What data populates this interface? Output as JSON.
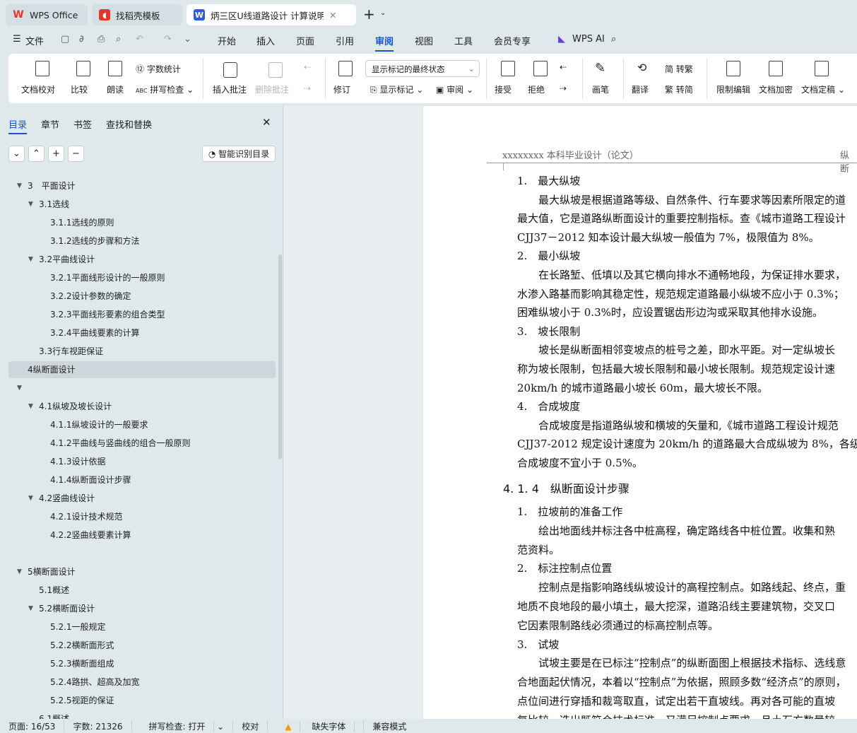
{
  "tabs": [
    {
      "label": "WPS Office",
      "icon": "wps-logo-icon"
    },
    {
      "label": "找稻壳模板",
      "icon": "docer-logo-icon"
    },
    {
      "label": "炳三区U线道路设计 计算说明书",
      "icon": "word-doc-icon",
      "active": true
    }
  ],
  "menu": {
    "file": "文件",
    "items": [
      "开始",
      "插入",
      "页面",
      "引用",
      "审阅",
      "视图",
      "工具",
      "会员专享"
    ],
    "active": "审阅",
    "ai": "WPS AI"
  },
  "ribbon": {
    "proofread": "文档校对",
    "compare": "比较",
    "read_aloud": "朗读",
    "word_count": "字数统计",
    "spell_check": "拼写检查",
    "insert_comment": "插入批注",
    "delete_comment": "删除批注",
    "track": "修订",
    "markup_state": "显示标记的最终状态",
    "show_markup": "显示标记",
    "review_pane": "审阅",
    "accept": "接受",
    "reject": "拒绝",
    "pen": "画笔",
    "translate": "翻译",
    "to_traditional": "转繁",
    "to_simplified": "转简",
    "restrict_edit": "限制编辑",
    "encrypt": "文档加密",
    "finalize": "文档定稿"
  },
  "sidebar": {
    "tabs": [
      "目录",
      "章节",
      "书签",
      "查找和替换"
    ],
    "active_tab": "目录",
    "smart_toc": "智能识别目录",
    "toc": [
      {
        "label": "3　平面设计",
        "level": 0,
        "expanded": true
      },
      {
        "label": "3.1选线",
        "level": 1,
        "expanded": true
      },
      {
        "label": "3.1.1选线的原则",
        "level": 2
      },
      {
        "label": "3.1.2选线的步骤和方法",
        "level": 2
      },
      {
        "label": "3.2平曲线设计",
        "level": 1,
        "expanded": true
      },
      {
        "label": "3.2.1平面线形设计的一般原则",
        "level": 2
      },
      {
        "label": "3.2.2设计参数的确定",
        "level": 2
      },
      {
        "label": "3.2.3平面线形要素的组合类型",
        "level": 2
      },
      {
        "label": "3.2.4平曲线要素的计算",
        "level": 2
      },
      {
        "label": "3.3行车视距保证",
        "level": 1
      },
      {
        "label": "4纵断面设计",
        "level": 0,
        "selected": true
      },
      {
        "label": "",
        "level": 0,
        "expanded": true
      },
      {
        "label": "4.1纵坡及坡长设计",
        "level": 1,
        "expanded": true
      },
      {
        "label": "4.1.1纵坡设计的一般要求",
        "level": 2
      },
      {
        "label": "4.1.2平曲线与竖曲线的组合一般原则",
        "level": 2
      },
      {
        "label": "4.1.3设计依据",
        "level": 2
      },
      {
        "label": "4.1.4纵断面设计步骤",
        "level": 2
      },
      {
        "label": "4.2竖曲线设计",
        "level": 1,
        "expanded": true
      },
      {
        "label": "4.2.1设计技术规范",
        "level": 2
      },
      {
        "label": "4.2.2竖曲线要素计算",
        "level": 2
      },
      {
        "label": "",
        "level": 0
      },
      {
        "label": "5横断面设计",
        "level": 0,
        "expanded": true
      },
      {
        "label": "5.1概述",
        "level": 1
      },
      {
        "label": "5.2横断面设计",
        "level": 1,
        "expanded": true
      },
      {
        "label": "5.2.1一般规定",
        "level": 2
      },
      {
        "label": "5.2.2横断面形式",
        "level": 2
      },
      {
        "label": "5.2.3横断面组成",
        "level": 2
      },
      {
        "label": "5.2.4路拱、超高及加宽",
        "level": 2
      },
      {
        "label": "5.2.5视距的保证",
        "level": 2
      },
      {
        "label": "6.1概述",
        "level": 1
      }
    ]
  },
  "document": {
    "header_left": "xxxxxxxx 本科毕业设计（论文）",
    "header_right": "纵断",
    "lines": [
      "1.　最大纵坡",
      "　　最大纵坡是根据道路等级、自然条件、行车要求等因素所限定的道",
      "最大值，它是道路纵断面设计的重要控制指标。查《城市道路工程设计",
      "CJJ37－2012 知本设计最大纵坡一般值为 7%，极限值为 8%。",
      "2.　最小纵坡",
      "　　在长路堑、低填以及其它横向排水不通畅地段，为保证排水要求，",
      "水渗入路基而影响其稳定性，规范规定道路最小纵坡不应小于 0.3%；",
      "困难纵坡小于 0.3%时，应设置锯齿形边沟或采取其他排水设施。",
      "3.　坡长限制",
      "　　坡长是纵断面相邻变坡点的桩号之差，即水平距。对一定纵坡长",
      "称为坡长限制，包括最大坡长限制和最小坡长限制。规范规定设计速",
      "20km/h 的城市道路最小坡长 60m，最大坡长不限。",
      "4.　合成坡度",
      "　　合成坡度是指道路纵坡和横坡的矢量和,《城市道路工程设计规范",
      "CJJ37-2012 规定设计速度为 20km/h 的道路最大合成纵坡为 8%，各级",
      "合成坡度不宜小于 0.5%。"
    ],
    "heading": "4. 1. 4　纵断面设计步骤",
    "lines2": [
      "1.　拉坡前的准备工作",
      "　　绘出地面线并标注各中桩高程，确定路线各中桩位置。收集和熟",
      "范资料。",
      "2.　标注控制点位置",
      "　　控制点是指影响路线纵坡设计的高程控制点。如路线起、终点，重",
      "地质不良地段的最小填土，最大挖深，道路沿线主要建筑物，交叉口",
      "它因素限制路线必须通过的标高控制点等。",
      "3.　试坡",
      "　　试坡主要是在已标注“控制点”的纵断面图上根据技术指标、选线意",
      "合地面起伏情况，本着以“控制点”为依据，照顾多数“经济点”的原则，",
      "点位间进行穿插和裁弯取直，试定出若干直坡线。再对各可能的直坡",
      "复比较，选出既符合技术标准，又满足控制点要求，且土石方数量较"
    ]
  },
  "status": {
    "page": "页面: 16/53",
    "words": "字数: 21326",
    "spell": "拼写检查: 打开",
    "proof": "校对",
    "missing_font": "缺失字体",
    "compat": "兼容模式"
  },
  "colors": {
    "accent": "#1b52d6",
    "wps_red": "#e8352a",
    "word_blue": "#2b5ce0"
  }
}
